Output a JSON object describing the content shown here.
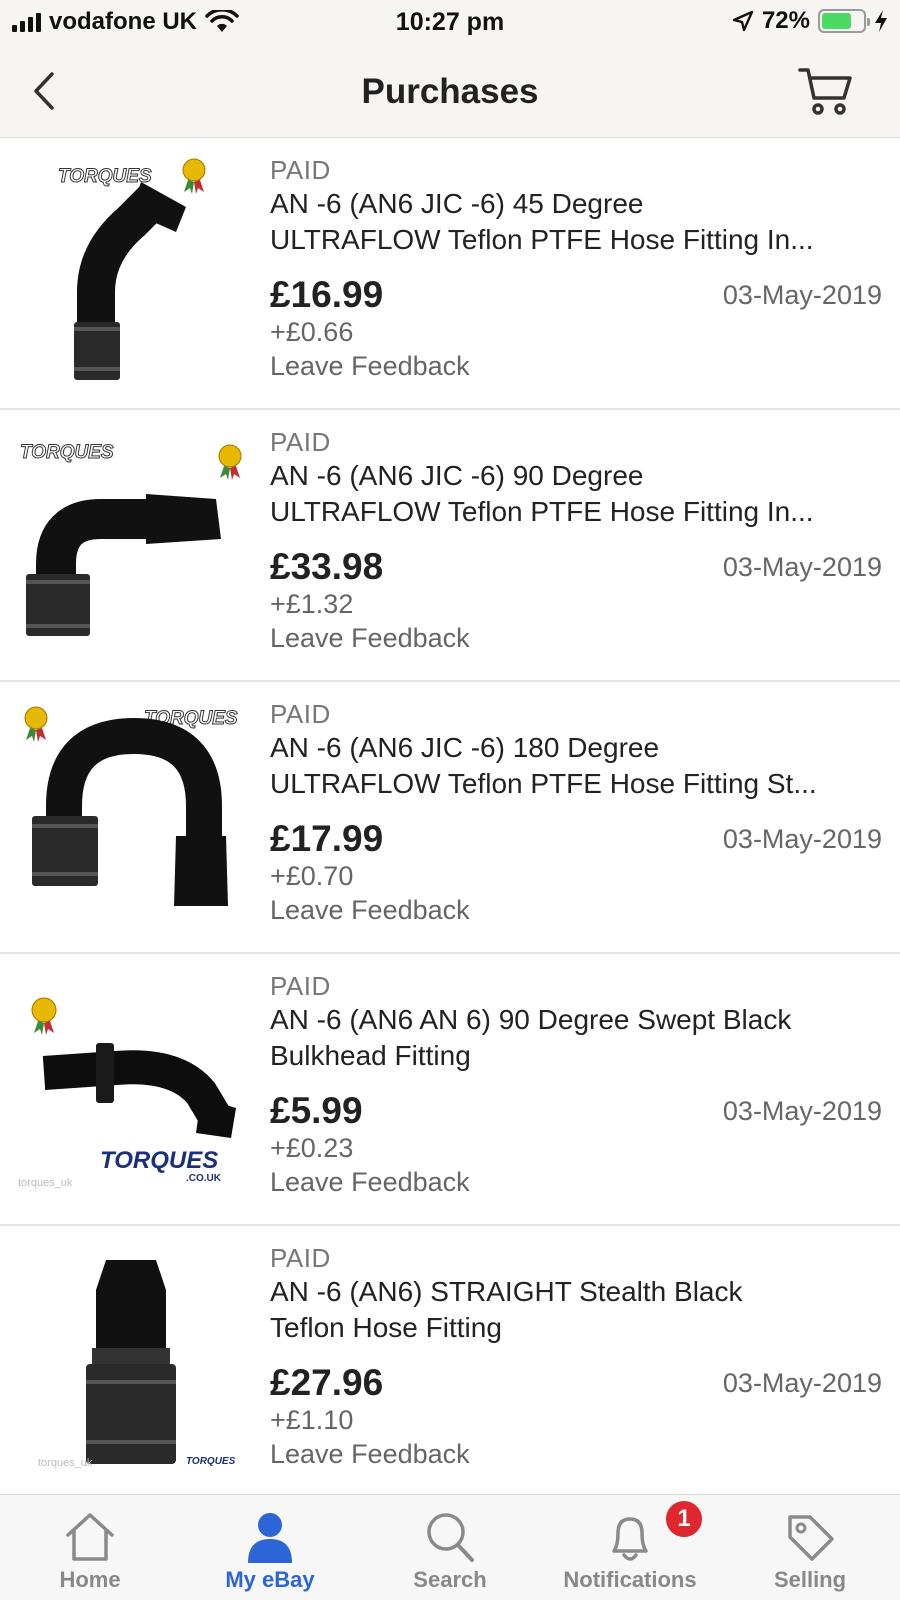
{
  "status_bar": {
    "carrier": "vodafone UK",
    "time": "10:27 pm",
    "battery_percent": "72%",
    "battery_level": 0.72,
    "battery_color": "#4cd964"
  },
  "nav": {
    "back_icon": "chevron-left-icon",
    "title": "Purchases",
    "cart_icon": "cart-icon"
  },
  "purchases": [
    {
      "status": "PAID",
      "title_line1": "AN -6 (AN6 JIC -6) 45 Degree",
      "title_line2": "ULTRAFLOW Teflon PTFE Hose Fitting In...",
      "price": "£16.99",
      "postage": "+£0.66",
      "date": "03-May-2019",
      "action": "Leave Feedback",
      "image_brand": "TORQUES"
    },
    {
      "status": "PAID",
      "title_line1": "AN -6 (AN6 JIC -6) 90 Degree",
      "title_line2": "ULTRAFLOW Teflon PTFE Hose Fitting In...",
      "price": "£33.98",
      "postage": "+£1.32",
      "date": "03-May-2019",
      "action": "Leave Feedback",
      "image_brand": "TORQUES"
    },
    {
      "status": "PAID",
      "title_line1": "AN -6 (AN6 JIC -6) 180 Degree",
      "title_line2": "ULTRAFLOW Teflon PTFE Hose Fitting  St...",
      "price": "£17.99",
      "postage": "+£0.70",
      "date": "03-May-2019",
      "action": "Leave Feedback",
      "image_brand": "TORQUES"
    },
    {
      "status": "PAID",
      "title_line1": "AN -6 (AN6 AN 6) 90 Degree Swept Black",
      "title_line2": "Bulkhead Fitting",
      "price": "£5.99",
      "postage": "+£0.23",
      "date": "03-May-2019",
      "action": "Leave Feedback",
      "image_brand": "TORQUES",
      "image_domain": ".CO.UK",
      "image_watermark": "torques_uk"
    },
    {
      "status": "PAID",
      "title_line1": "AN -6 (AN6) STRAIGHT Stealth Black",
      "title_line2": "Teflon Hose Fitting",
      "price": "£27.96",
      "postage": "+£1.10",
      "date": "03-May-2019",
      "action": "Leave Feedback",
      "image_brand": "TORQUES",
      "image_watermark": "torques_uk"
    }
  ],
  "tab_bar": {
    "active_color": "#2c66d6",
    "badge_color": "#e0262e",
    "tabs": [
      {
        "label": "Home",
        "icon": "home-icon"
      },
      {
        "label": "My eBay",
        "icon": "person-icon"
      },
      {
        "label": "Search",
        "icon": "search-icon"
      },
      {
        "label": "Notifications",
        "icon": "bell-icon",
        "badge": "1"
      },
      {
        "label": "Selling",
        "icon": "tag-icon"
      }
    ]
  }
}
